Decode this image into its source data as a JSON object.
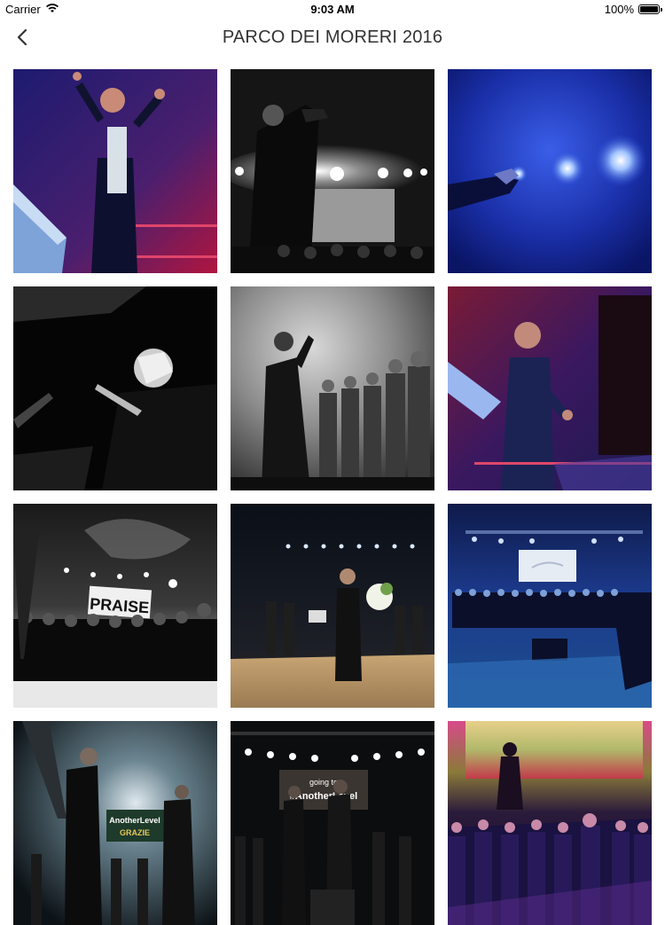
{
  "status_bar": {
    "carrier": "Carrier",
    "time": "9:03 AM",
    "battery": "100%"
  },
  "nav": {
    "title": "PARCO DEI MORERI 2016",
    "back_icon": "chevron-left-icon"
  },
  "photos": [
    {
      "name": "photo-1"
    },
    {
      "name": "photo-2"
    },
    {
      "name": "photo-3"
    },
    {
      "name": "photo-4"
    },
    {
      "name": "photo-5"
    },
    {
      "name": "photo-6"
    },
    {
      "name": "photo-7",
      "sign_text": "PRAISE"
    },
    {
      "name": "photo-8"
    },
    {
      "name": "photo-9"
    },
    {
      "name": "photo-10",
      "sign_text": "AnotherLevel",
      "sign_text_2": "GRAZIE"
    },
    {
      "name": "photo-11",
      "sign_text": "going to",
      "sign_text_2": "#AnotherLevel"
    },
    {
      "name": "photo-12"
    }
  ]
}
